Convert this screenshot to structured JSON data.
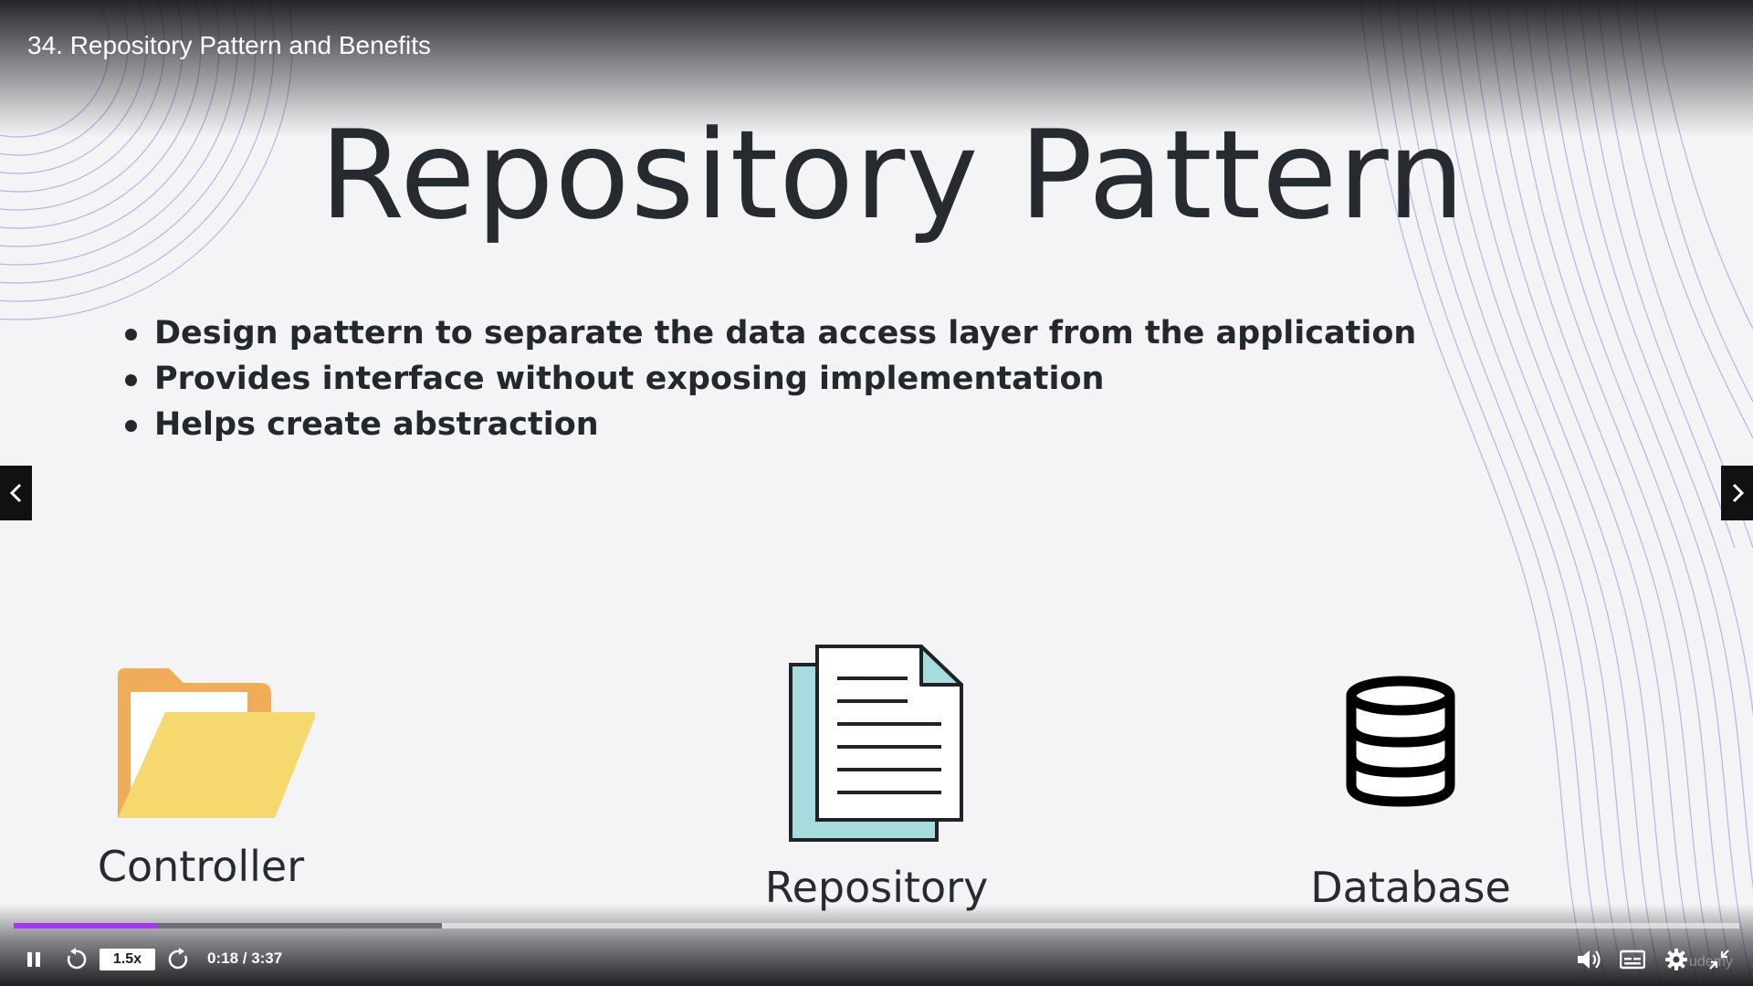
{
  "player": {
    "video_title": "34. Repository Pattern and Benefits",
    "speed_label": "1.5x",
    "time_display": "0:18 / 3:37",
    "progress_fraction": 0.083,
    "buffered_fraction": 0.248,
    "watermark": "udemy",
    "accent_color": "#a435f0",
    "icons": [
      "pause-icon",
      "rewind-icon",
      "forward-icon",
      "volume-icon",
      "captions-icon",
      "settings-icon",
      "exit-fullscreen-icon",
      "prev-arrow-icon",
      "next-arrow-icon"
    ]
  },
  "slide": {
    "title": "Repository Pattern",
    "bullets": [
      "Design pattern to separate the data access layer from the application",
      "Provides interface without exposing implementation",
      "Helps create abstraction"
    ],
    "diagram": {
      "items": [
        {
          "label": "Controller",
          "icon": "folder-icon"
        },
        {
          "label": "Repository",
          "icon": "document-icon"
        },
        {
          "label": "Database",
          "icon": "database-icon"
        }
      ]
    }
  }
}
